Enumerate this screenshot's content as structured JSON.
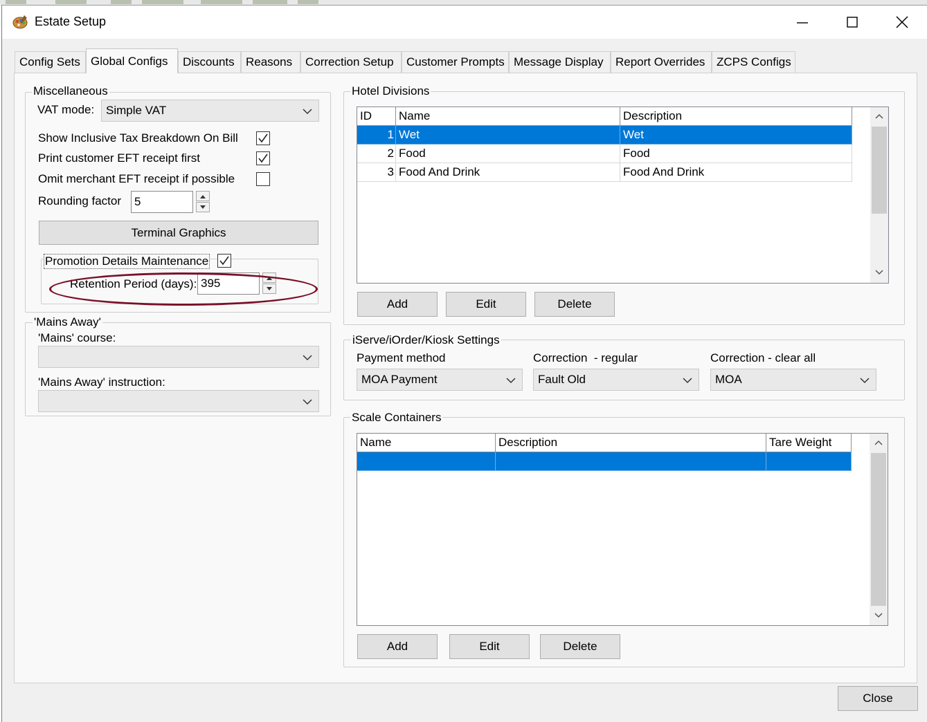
{
  "window": {
    "title": "Estate Setup",
    "controls": {
      "minimize": "minimize-icon",
      "maximize": "maximize-icon",
      "close": "close-icon"
    }
  },
  "tabs": [
    {
      "label": "Config Sets",
      "active": false
    },
    {
      "label": "Global Configs",
      "active": true
    },
    {
      "label": "Discounts",
      "active": false
    },
    {
      "label": "Reasons",
      "active": false
    },
    {
      "label": "Correction Setup",
      "active": false
    },
    {
      "label": "Customer Prompts",
      "active": false
    },
    {
      "label": "Message Display",
      "active": false
    },
    {
      "label": "Report Overrides",
      "active": false
    },
    {
      "label": "ZCPS Configs",
      "active": false
    }
  ],
  "miscellaneous": {
    "group_label": "Miscellaneous",
    "vat_mode_label": "VAT mode:",
    "vat_mode_value": "Simple VAT",
    "show_inclusive_tax_label": "Show Inclusive Tax Breakdown On Bill",
    "show_inclusive_tax_checked": true,
    "print_customer_eft_label": "Print customer EFT receipt first",
    "print_customer_eft_checked": true,
    "omit_merchant_eft_label": "Omit merchant EFT receipt if possible",
    "omit_merchant_eft_checked": false,
    "rounding_factor_label": "Rounding factor",
    "rounding_factor_value": "5",
    "terminal_graphics_label": "Terminal Graphics",
    "promotion_details_label": "Promotion Details Maintenance",
    "promotion_details_checked": true,
    "retention_period_label": "Retention Period (days):",
    "retention_period_value": "395"
  },
  "mains_away": {
    "group_label": "'Mains Away'",
    "mains_course_label": "'Mains' course:",
    "mains_course_value": "",
    "instruction_label": "'Mains Away' instruction:",
    "instruction_value": ""
  },
  "hotel_divisions": {
    "group_label": "Hotel Divisions",
    "columns": [
      "ID",
      "Name",
      "Description"
    ],
    "rows": [
      {
        "id": "1",
        "name": "Wet",
        "description": "Wet",
        "selected": true
      },
      {
        "id": "2",
        "name": "Food",
        "description": "Food",
        "selected": false
      },
      {
        "id": "3",
        "name": "Food And Drink",
        "description": "Food And Drink",
        "selected": false
      }
    ],
    "add_label": "Add",
    "edit_label": "Edit",
    "delete_label": "Delete"
  },
  "iserve": {
    "group_label": "iServe/iOrder/Kiosk Settings",
    "payment_method_label": "Payment method",
    "payment_method_value": "MOA Payment",
    "correction_regular_label": "Correction  - regular",
    "correction_regular_value": "Fault Old",
    "correction_clear_label": "Correction - clear all",
    "correction_clear_value": "MOA"
  },
  "scale_containers": {
    "group_label": "Scale Containers",
    "columns": [
      "Name",
      "Description",
      "Tare Weight"
    ],
    "add_label": "Add",
    "edit_label": "Edit",
    "delete_label": "Delete"
  },
  "footer": {
    "close_label": "Close"
  },
  "colors": {
    "selection": "#0078d7",
    "highlight_ellipse": "#7a1028",
    "panel": "#f9f9f9"
  }
}
